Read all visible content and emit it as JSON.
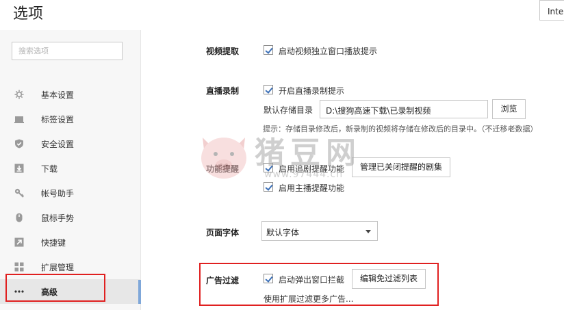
{
  "header": {
    "title": "选项",
    "language_value": "Inter"
  },
  "sidebar": {
    "search_placeholder": "搜索选项",
    "items": [
      {
        "label": "基本设置",
        "icon": "gear-icon"
      },
      {
        "label": "标签设置",
        "icon": "tab-icon"
      },
      {
        "label": "安全设置",
        "icon": "shield-icon"
      },
      {
        "label": "下载",
        "icon": "download-icon"
      },
      {
        "label": "帐号助手",
        "icon": "key-icon"
      },
      {
        "label": "鼠标手势",
        "icon": "mouse-icon"
      },
      {
        "label": "快捷键",
        "icon": "shortcut-arrow-icon"
      },
      {
        "label": "扩展管理",
        "icon": "extensions-grid-icon"
      },
      {
        "label": "高级",
        "icon": "more-dots-icon",
        "active": true
      }
    ]
  },
  "main": {
    "video": {
      "label": "视频提取",
      "popout_hint": {
        "label": "启动视频独立窗口播放提示",
        "checked": true
      }
    },
    "live_record": {
      "label": "直播录制",
      "record_hint": {
        "label": "开启直播录制提示",
        "checked": true
      },
      "dir_label": "默认存储目录",
      "dir_value": "D:\\搜狗高速下载\\已录制视频",
      "browse_label": "浏览",
      "note": "提示：存储目录修改后，新录制的视频将存储在修改后的目录中。（不迁移老数据）"
    },
    "reminder": {
      "label": "功能提醒",
      "follow_show": {
        "label": "启用追剧提醒功能",
        "checked": true
      },
      "manage_button": "管理已关闭提醒的剧集",
      "anchor": {
        "label": "启用主播提醒功能",
        "checked": true
      }
    },
    "font": {
      "label": "页面字体",
      "selected": "默认字体"
    },
    "ad_filter": {
      "label": "广告过滤",
      "popup_block": {
        "label": "启动弹出窗口拦截",
        "checked": true
      },
      "edit_button": "编辑免过滤列表",
      "more_link": "使用扩展过滤更多广告..."
    }
  },
  "watermark": {
    "text": "猪豆网",
    "url": "www.97444.cn"
  },
  "colors": {
    "annotation_red": "#e02020",
    "check_blue": "#3a6fb7",
    "sidebar_bg": "#f7f7f7",
    "scrollbar": "#7fa7d9"
  }
}
